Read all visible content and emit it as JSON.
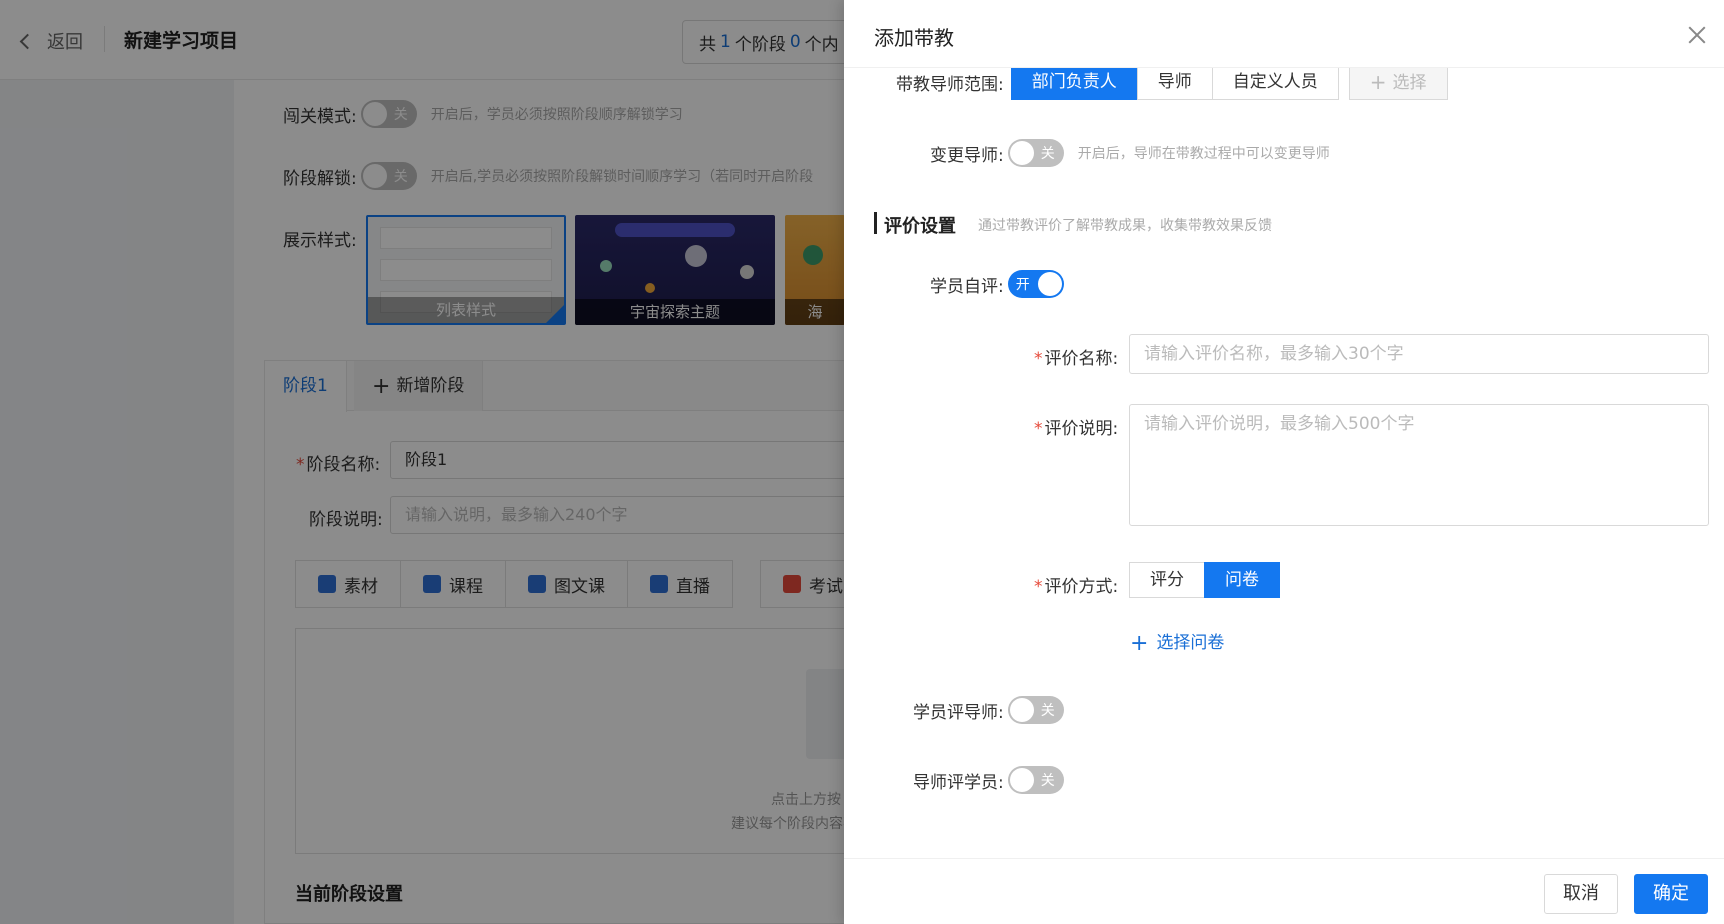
{
  "page": {
    "back_label": "返回",
    "title": "新建学习项目",
    "stats": {
      "prefix": "共",
      "stages": "1",
      "stage_unit": "个阶段",
      "items": "0",
      "items_unit": "个内"
    }
  },
  "settings": {
    "challenge_mode": {
      "label": "闯关模式:",
      "state": "关",
      "hint": "开启后，学员必须按照阶段顺序解锁学习"
    },
    "stage_unlock": {
      "label": "阶段解锁:",
      "state": "关",
      "hint": "开启后,学员必须按照阶段解锁时间顺序学习（若同时开启阶段"
    },
    "display_style": {
      "label": "展示样式:",
      "themes": [
        {
          "label": "列表样式",
          "selected": true
        },
        {
          "label": "宇宙探索主题",
          "selected": false
        },
        {
          "label": "海",
          "selected": false
        }
      ]
    }
  },
  "stage_tabs": [
    {
      "label": "阶段1",
      "active": true
    },
    {
      "label": "新增阶段",
      "active": false
    }
  ],
  "stage_form": {
    "name_label": "阶段名称:",
    "name_value": "阶段1",
    "desc_label": "阶段说明:",
    "desc_placeholder": "请输入说明，最多输入240个字"
  },
  "content_tools": [
    {
      "label": "素材",
      "icon": "folder-icon"
    },
    {
      "label": "课程",
      "icon": "course-icon"
    },
    {
      "label": "图文课",
      "icon": "image-text-icon"
    },
    {
      "label": "直播",
      "icon": "live-icon"
    },
    {
      "label": "考试",
      "icon": "exam-icon"
    }
  ],
  "dropzone": {
    "line1": "点击上方按",
    "line2": "建议每个阶段内容不超过"
  },
  "current_stage_settings": "当前阶段设置",
  "drawer": {
    "title": "添加带教",
    "mentor_scope": {
      "label": "带教导师范围:",
      "options": [
        {
          "label": "部门负责人",
          "active": true
        },
        {
          "label": "导师",
          "active": false
        },
        {
          "label": "自定义人员",
          "active": false
        }
      ],
      "select_label": "选择"
    },
    "change_mentor": {
      "label": "变更导师:",
      "state": "关",
      "hint": "开启后，导师在带教过程中可以变更导师"
    },
    "evaluation_section": {
      "title": "评价设置",
      "desc": "通过带教评价了解带教成果，收集带教效果反馈"
    },
    "self_eval": {
      "label": "学员自评:",
      "state": "开"
    },
    "eval_name": {
      "label": "评价名称:",
      "placeholder": "请输入评价名称，最多输入30个字"
    },
    "eval_desc": {
      "label": "评价说明:",
      "placeholder": "请输入评价说明，最多输入500个字"
    },
    "eval_method": {
      "label": "评价方式:",
      "options": [
        {
          "label": "评分",
          "active": false
        },
        {
          "label": "问卷",
          "active": true
        }
      ]
    },
    "select_questionnaire": "选择问卷",
    "student_rates_mentor": {
      "label": "学员评导师:",
      "state": "关"
    },
    "mentor_rates_student": {
      "label": "导师评学员:",
      "state": "关"
    },
    "footer": {
      "cancel": "取消",
      "confirm": "确定"
    }
  },
  "colors": {
    "primary": "#1478f0",
    "required": "#e64a3b",
    "toggle_off": "#bfbfbf"
  }
}
